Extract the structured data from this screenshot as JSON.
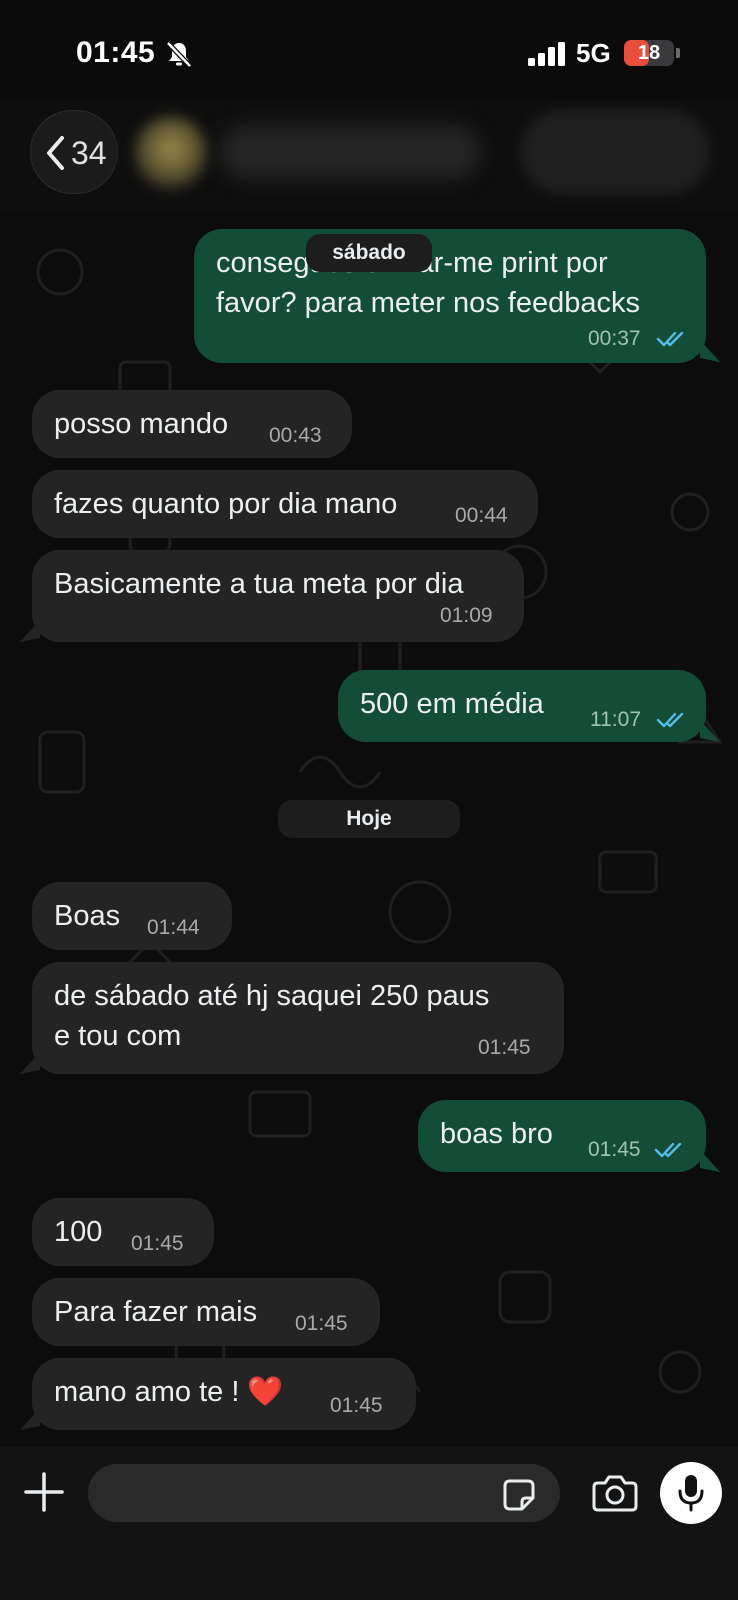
{
  "status_bar": {
    "time": "01:45",
    "network": "5G",
    "battery": "18",
    "battery_level": 0.18,
    "icons": [
      "bell-slash-icon",
      "signal-icon",
      "battery-icon"
    ]
  },
  "header": {
    "back_count": "34",
    "icons": [
      "chevron-left-icon"
    ]
  },
  "messages": [
    {
      "direction": "out",
      "text_lines": [
        "consegues enviar-me print por",
        "favor? para meter nos feedbacks"
      ],
      "time": "00:37",
      "status": "read"
    },
    {
      "direction": "in",
      "text_lines": [
        "posso mando"
      ],
      "time": "00:43"
    },
    {
      "direction": "in",
      "text_lines": [
        "fazes quanto por dia mano"
      ],
      "time": "00:44"
    },
    {
      "direction": "in",
      "text_lines": [
        "Basicamente a tua meta por dia"
      ],
      "time": "01:09"
    },
    {
      "direction": "out",
      "text_lines": [
        "500 em média"
      ],
      "time": "11:07",
      "status": "read"
    },
    {
      "direction": "in",
      "text_lines": [
        "Boas"
      ],
      "time": "01:44"
    },
    {
      "direction": "in",
      "text_lines": [
        "de sábado até hj saquei 250 paus",
        "e tou com"
      ],
      "time": "01:45"
    },
    {
      "direction": "out",
      "text_lines": [
        "boas bro"
      ],
      "time": "01:45",
      "status": "read"
    },
    {
      "direction": "in",
      "text_lines": [
        "100"
      ],
      "time": "01:45"
    },
    {
      "direction": "in",
      "text_lines": [
        "Para fazer mais"
      ],
      "time": "01:45"
    },
    {
      "direction": "in",
      "text_lines": [
        "mano amo te ! ❤️"
      ],
      "time": "01:45"
    }
  ],
  "date_chips": [
    "sábado",
    "Hoje"
  ],
  "composer": {
    "placeholder": "",
    "icons": [
      "plus-icon",
      "sticker-icon",
      "camera-icon",
      "mic-icon"
    ]
  },
  "colors": {
    "incoming_bubble": "#242424",
    "outgoing_bubble": "#144d37",
    "read_ticks": "#53bdeb",
    "background": "#0b0b0b"
  }
}
